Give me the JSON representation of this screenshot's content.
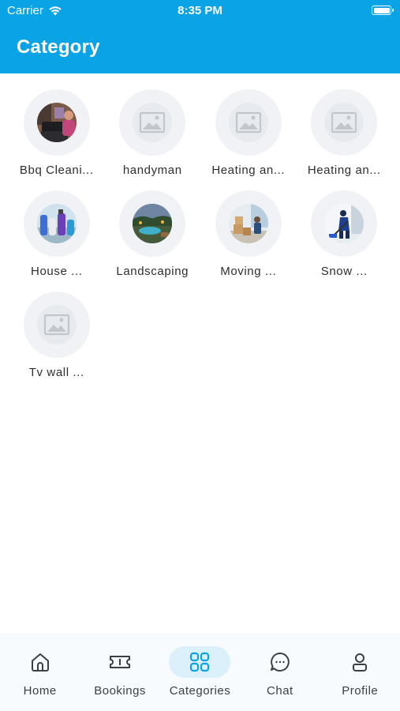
{
  "status_bar": {
    "carrier": "Carrier",
    "time": "8:35 PM"
  },
  "header": {
    "title": "Category"
  },
  "categories": [
    {
      "label": "Bbq Cleani...",
      "image": "bbq-photo"
    },
    {
      "label": "handyman",
      "image": "placeholder-image-icon"
    },
    {
      "label": "Heating an...",
      "image": "placeholder-image-icon"
    },
    {
      "label": "Heating an...",
      "image": "placeholder-image-icon"
    },
    {
      "label": "House ...",
      "image": "house-cleaning-photo"
    },
    {
      "label": "Landscaping",
      "image": "landscaping-photo"
    },
    {
      "label": "Moving ...",
      "image": "moving-photo"
    },
    {
      "label": "Snow ...",
      "image": "snow-removal-photo"
    },
    {
      "label": "Tv wall ...",
      "image": "placeholder-image-icon"
    }
  ],
  "tabbar": {
    "active_color": "#0aa3e6",
    "items": [
      {
        "label": "Home",
        "icon": "home-icon"
      },
      {
        "label": "Bookings",
        "icon": "ticket-icon"
      },
      {
        "label": "Categories",
        "icon": "grid-icon",
        "active": true
      },
      {
        "label": "Chat",
        "icon": "chat-bubble-icon"
      },
      {
        "label": "Profile",
        "icon": "user-icon"
      }
    ]
  },
  "colors": {
    "header": "#0aa3e6",
    "tile_bg": "#f0f2f5",
    "text": "#2b2f33"
  }
}
